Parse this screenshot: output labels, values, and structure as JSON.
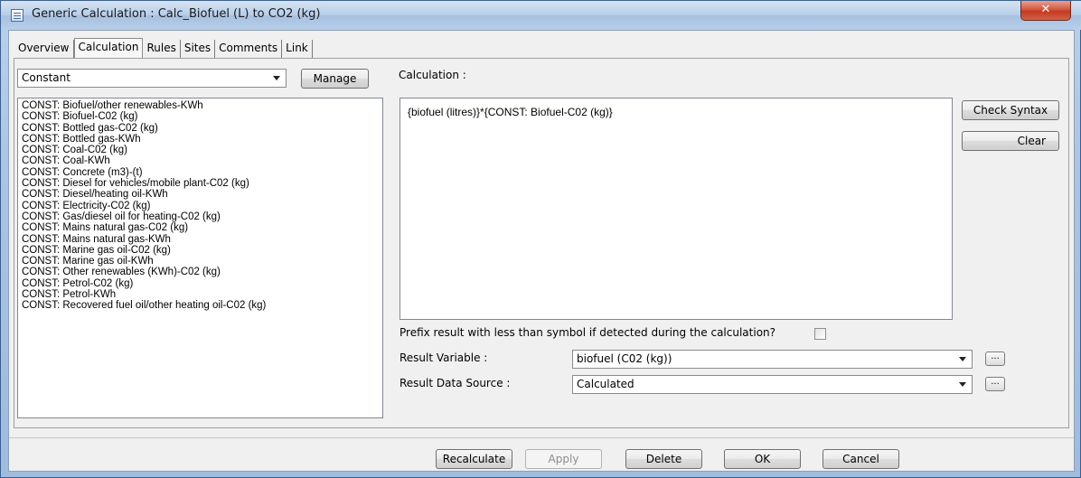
{
  "window": {
    "title": "Generic Calculation : Calc_Biofuel (L) to CO2 (kg)",
    "close_label": "✕"
  },
  "tabs": [
    "Overview",
    "Calculation",
    "Rules",
    "Sites",
    "Comments",
    "Link"
  ],
  "active_tab": "Calculation",
  "left": {
    "type_select": "Constant",
    "manage_label": "Manage",
    "constants": [
      "CONST: Biofuel/other renewables-KWh",
      "CONST: Biofuel-C02 (kg)",
      "CONST: Bottled gas-C02 (kg)",
      "CONST: Bottled gas-KWh",
      "CONST: Coal-C02 (kg)",
      "CONST: Coal-KWh",
      "CONST: Concrete (m3)-(t)",
      "CONST: Diesel for vehicles/mobile plant-C02 (kg)",
      "CONST: Diesel/heating oil-KWh",
      "CONST: Electricity-C02 (kg)",
      "CONST: Gas/diesel oil for heating-C02 (kg)",
      "CONST: Mains natural gas-C02 (kg)",
      "CONST: Mains natural gas-KWh",
      "CONST: Marine gas oil-C02 (kg)",
      "CONST: Marine gas oil-KWh",
      "CONST: Other renewables (KWh)-C02 (kg)",
      "CONST: Petrol-C02 (kg)",
      "CONST: Petrol-KWh",
      "CONST: Recovered fuel oil/other heating oil-C02 (kg)"
    ]
  },
  "right": {
    "calculation_label": "Calculation :",
    "calculation_text": "{biofuel (litres)}*{CONST: Biofuel-C02 (kg)}",
    "check_syntax_label": "Check Syntax",
    "clear_label": "Clear",
    "prefix_label": "Prefix result with less than symbol if detected during the calculation?",
    "result_variable_label": "Result Variable :",
    "result_variable_value": "biofuel (C02 (kg))",
    "result_source_label": "Result Data Source :",
    "result_source_value": "Calculated",
    "ellipsis": "..."
  },
  "footer": {
    "recalculate": "Recalculate",
    "apply": "Apply",
    "delete": "Delete",
    "ok": "OK",
    "cancel": "Cancel"
  }
}
